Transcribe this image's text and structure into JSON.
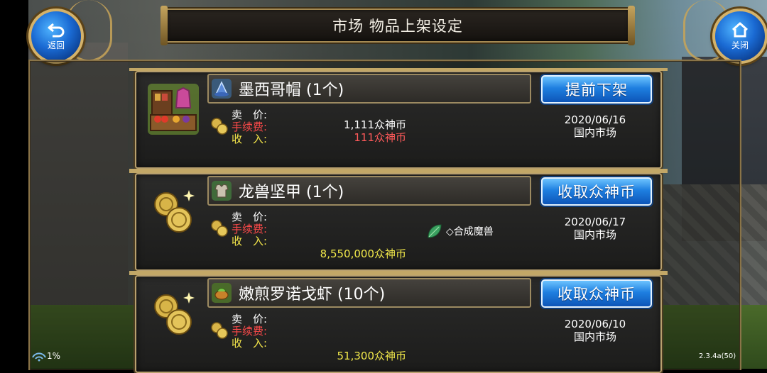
{
  "header": {
    "title": "市场 物品上架设定",
    "back_label": "返回",
    "close_label": "关闭"
  },
  "items": [
    {
      "name": "墨西哥帽",
      "qty": "(1个)",
      "icon": "wizard-hat-icon",
      "action": "提前下架",
      "sell_label": "卖　价:",
      "fee_label": "手续费:",
      "income_label": "收　入:",
      "sell_price": "1,111众神币",
      "fee": "111众神币",
      "income": "",
      "note": "",
      "date": "2020/06/16",
      "market": "国内市场"
    },
    {
      "name": "龙兽坚甲",
      "qty": "(1个)",
      "icon": "armor-icon",
      "action": "收取众神币",
      "sell_label": "卖　价:",
      "fee_label": "手续费:",
      "income_label": "收　入:",
      "sell_price": "",
      "fee": "",
      "income": "8,550,000众神币",
      "note": "◇合成魔兽",
      "date": "2020/06/17",
      "market": "国内市场"
    },
    {
      "name": "嫩煎罗诺戈虾",
      "qty": "(10个)",
      "icon": "shrimp-dish-icon",
      "action": "收取众神币",
      "sell_label": "卖　价:",
      "fee_label": "手续费:",
      "income_label": "收　入:",
      "sell_price": "",
      "fee": "",
      "income": "51,300众神币",
      "note": "",
      "date": "2020/06/10",
      "market": "国内市场"
    }
  ],
  "status": {
    "battery": "1%",
    "version": "2.3.4a(50)"
  },
  "colors": {
    "button_blue": "#1e7fe0",
    "fee_red": "#ff4a4a",
    "income_yellow": "#f4e64a",
    "frame_gold": "#b8a06e"
  }
}
